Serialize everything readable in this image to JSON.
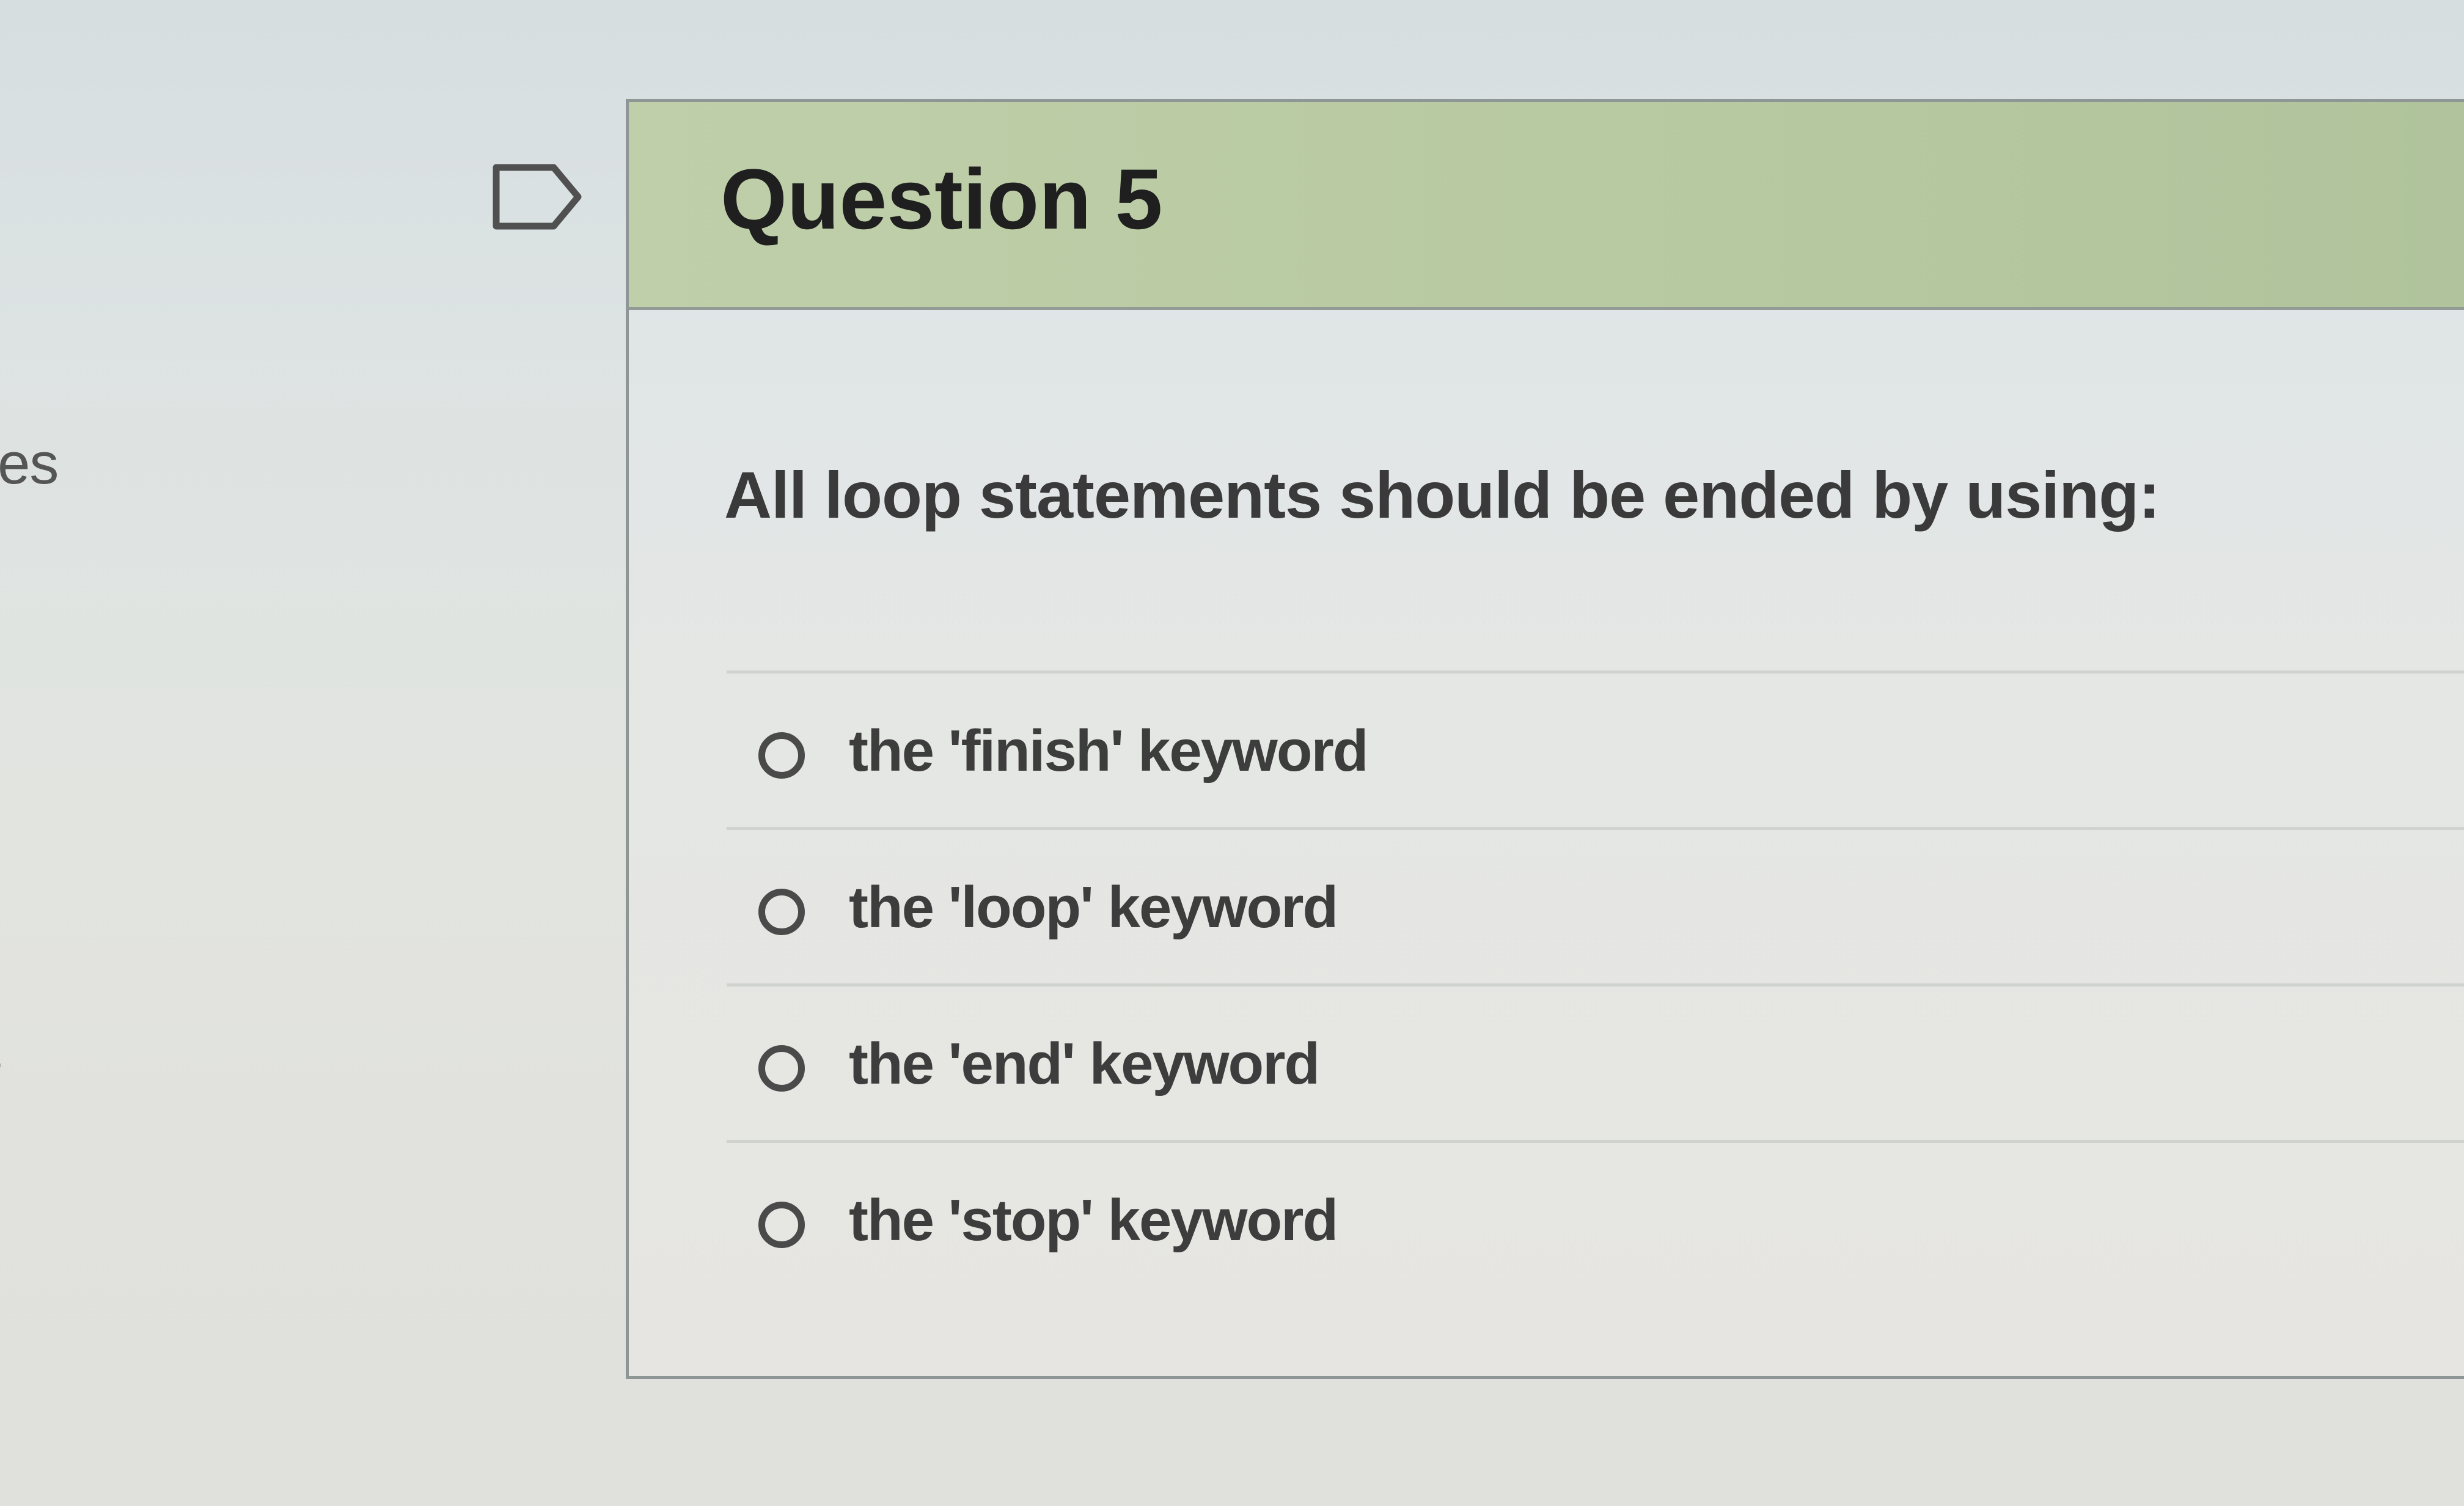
{
  "sidebar": {
    "fragment_1": "es",
    "fragment_2": "s"
  },
  "question": {
    "title": "Question 5",
    "prompt": "All loop statements should be ended by using:",
    "flag_icon": "bookmark-flag-icon",
    "answers": [
      {
        "label": "the 'finish' keyword",
        "selected": false
      },
      {
        "label": "the 'loop' keyword",
        "selected": false
      },
      {
        "label": "the 'end' keyword",
        "selected": false
      },
      {
        "label": "the 'stop' keyword",
        "selected": false
      }
    ]
  },
  "colors": {
    "header_bg": "#b9cba2",
    "card_border": "#8e9696",
    "radio": "#4a4a4a"
  }
}
